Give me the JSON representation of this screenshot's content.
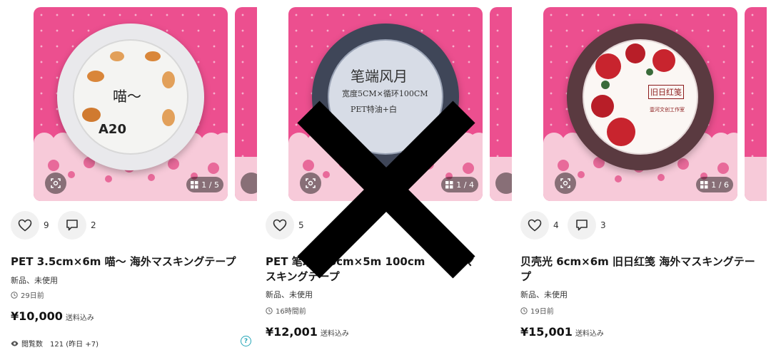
{
  "cards": [
    {
      "tape_text": "喵～",
      "tape_code": "A20",
      "image_count": "1 / 5",
      "likes": "9",
      "comments": "2",
      "title": "PET 3.5cm×6m 喵～ 海外マスキングテープ",
      "condition": "新品、未使用",
      "posted": "29日前",
      "price": "¥10,000",
      "shipping": "送料込み",
      "views_label": "閲覧数",
      "views_value": "121 (昨日 +7)"
    },
    {
      "tape_text": "笔端风月",
      "tape_sub": "宽度5CM×循环100CM",
      "tape_sub2": "PET特油+白",
      "image_count": "1 / 4",
      "likes": "5",
      "title_line1": "PET 笔端",
      "title_line1_end": "6cm×5m 100cm",
      "title_line1_tail": "海外マ",
      "title_line2": "スキングテープ",
      "condition": "新品、未使用",
      "posted": "16時間前",
      "price": "¥12,001",
      "shipping": "送料込み"
    },
    {
      "tape_text": "旧日红笺",
      "tape_sub": "壹河文创工作室",
      "image_count": "1 / 6",
      "likes": "4",
      "comments": "3",
      "title": "贝壳光 6cm×6m 旧日红笺 海外マスキングテープ",
      "condition": "新品、未使用",
      "posted": "19日前",
      "price": "¥15,001",
      "shipping": "送料込み"
    }
  ],
  "icons": {
    "heart": "heart-icon",
    "comment": "comment-icon",
    "scan": "scan-icon",
    "gallery": "gallery-icon",
    "clock": "clock-icon",
    "eye": "eye-icon",
    "help": "help-icon",
    "cross": "cross-mark-icon"
  },
  "colors": {
    "photo_bg": "#ec4f8f",
    "help_accent": "#27a7b8"
  }
}
